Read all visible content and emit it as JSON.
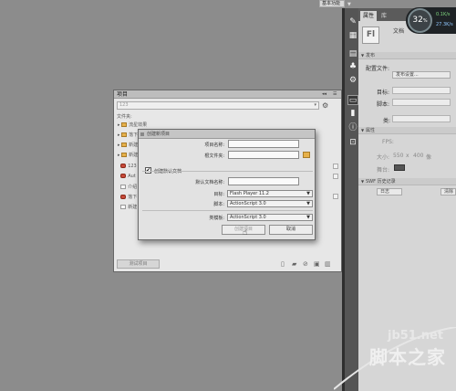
{
  "topbar": {
    "workspace_label": "基本功能"
  },
  "tool_icons": [
    "paint-icon",
    "image-icon",
    "chart-icon",
    "component-icon",
    "transform-icon",
    "library-icon",
    "properties-icon",
    "info-icon",
    "align-icon"
  ],
  "right_panel": {
    "tabs": [
      "属性",
      "库"
    ],
    "doc_badge": "Fl",
    "doc_label": "文档",
    "section_publish": "发布",
    "profile_label": "配置文件:",
    "publish_settings": "发布设置...",
    "target_label": "目标:",
    "script_label": "脚本:",
    "class_label": "类:",
    "section_props": "属性",
    "fps_label": "FPS:",
    "size_label": "大小:",
    "size_w": "550",
    "size_x": "x",
    "size_h": "400",
    "size_unit": "像",
    "stage_label": "舞台:",
    "section_history": "SWF 历史记录",
    "log_button": "日志",
    "clear_button": "清除"
  },
  "perf": {
    "percent": "32",
    "unit": "%",
    "up": "0.1K/s",
    "down": "27.3K/s"
  },
  "project_panel": {
    "title": "项目",
    "selector": "123",
    "files_label": "文件夹:",
    "items": [
      {
        "name": "流星效果",
        "icon": "folder"
      },
      {
        "name": "落下",
        "icon": "folder"
      },
      {
        "name": "新建",
        "icon": "folder"
      },
      {
        "name": "新建",
        "icon": "folder"
      },
      {
        "name": "123",
        "icon": "red"
      },
      {
        "name": "Aut",
        "icon": "red"
      },
      {
        "name": "介绍",
        "icon": "file"
      },
      {
        "name": "落下",
        "icon": "red"
      },
      {
        "name": "新建",
        "icon": "file"
      }
    ],
    "test_button": "测试项目"
  },
  "dialog": {
    "title": "创建新项目",
    "project_name_label": "项目名称:",
    "project_name_value": "",
    "root_folder_label": "根文件夹:",
    "root_folder_value": "",
    "default_doc_check": "创建默认文档",
    "default_doc_name_label": "默认文档名称:",
    "default_doc_name_value": "",
    "target_label": "目标:",
    "target_value": "Flash Player 11.2",
    "script_label": "脚本:",
    "script_value": "ActionScript 3.0",
    "template_label": "类模板:",
    "template_value": "ActionScript 3.0",
    "create_button": "创建项目",
    "cancel_button": "取消"
  },
  "watermark": {
    "site": "jb51.net",
    "brand": "脚本之家"
  }
}
